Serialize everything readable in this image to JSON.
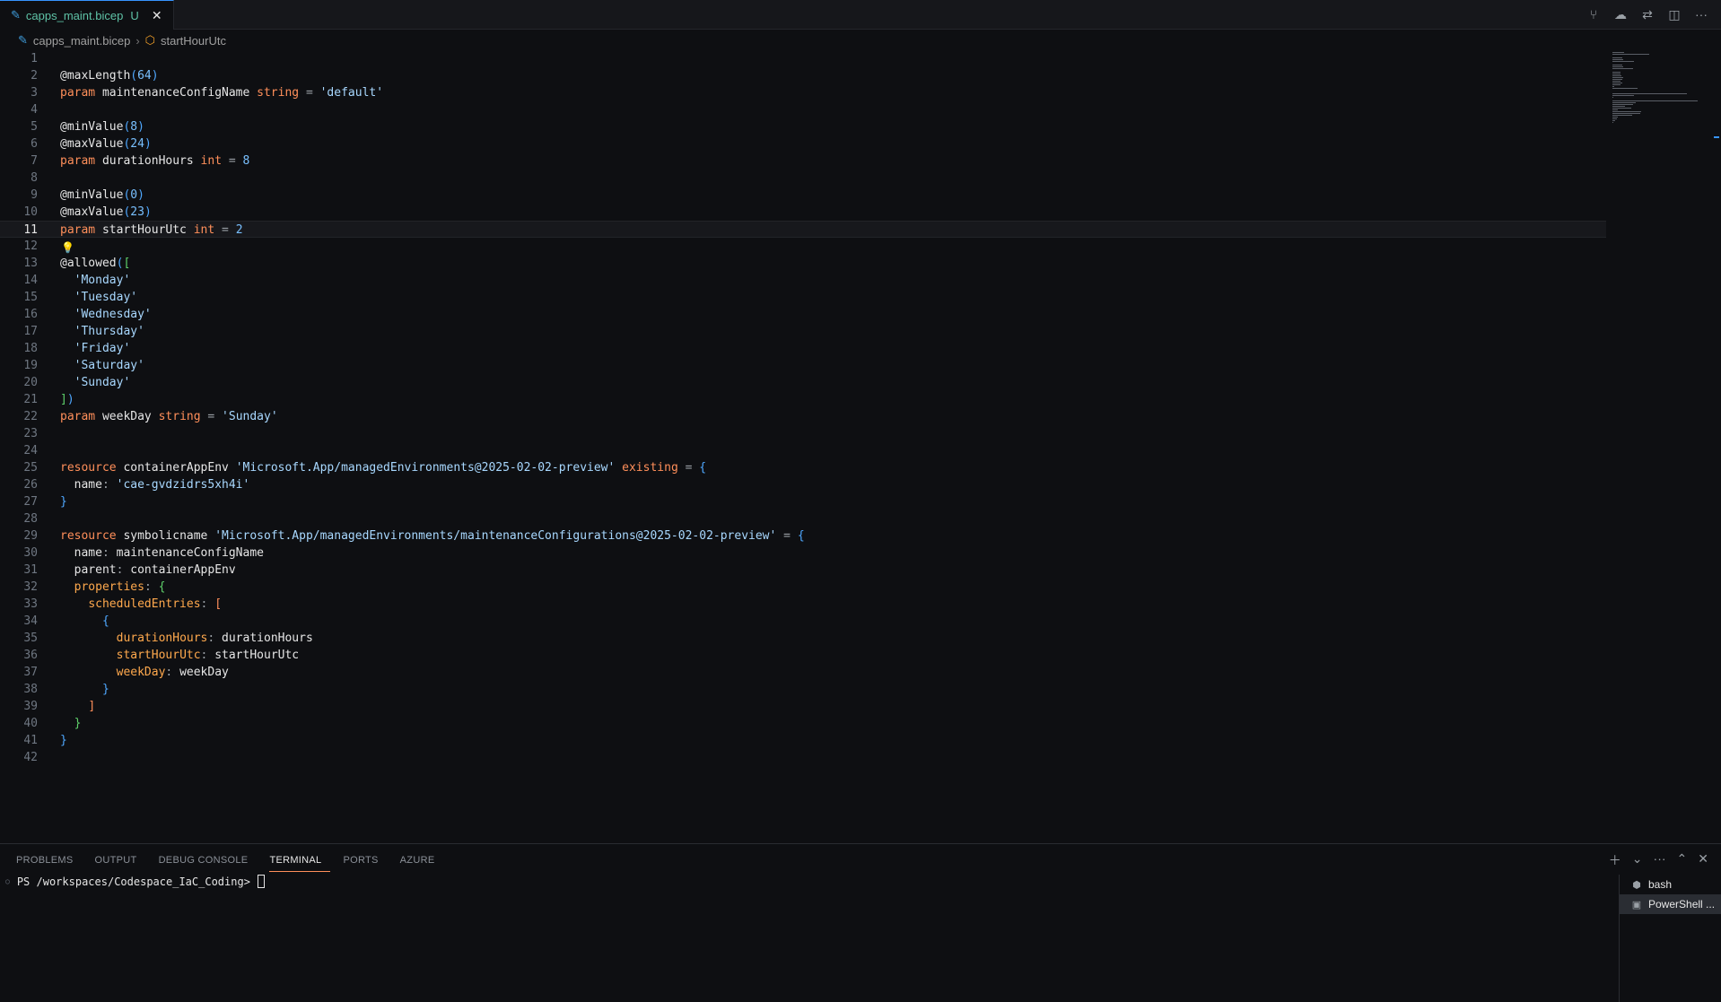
{
  "tab": {
    "label": "capps_maint.bicep",
    "modified": "U",
    "close": "✕"
  },
  "toolbar_icons": [
    "source-control-graph-icon",
    "cloud-upload-icon",
    "compare-changes-icon",
    "split-editor-icon",
    "more-actions-icon"
  ],
  "breadcrumb": {
    "file": "capps_maint.bicep",
    "symbol": "startHourUtc"
  },
  "editor": {
    "current_line": 11,
    "lines": [
      [],
      [
        [
          "dec",
          "@maxLength"
        ],
        [
          "b1",
          "("
        ],
        [
          "num",
          "64"
        ],
        [
          "b1",
          ")"
        ]
      ],
      [
        [
          "kw",
          "param"
        ],
        [
          "id",
          " maintenanceConfigName "
        ],
        [
          "type",
          "string"
        ],
        [
          "p",
          " = "
        ],
        [
          "str",
          "'default'"
        ]
      ],
      [],
      [
        [
          "dec",
          "@minValue"
        ],
        [
          "b1",
          "("
        ],
        [
          "num",
          "8"
        ],
        [
          "b1",
          ")"
        ]
      ],
      [
        [
          "dec",
          "@maxValue"
        ],
        [
          "b1",
          "("
        ],
        [
          "num",
          "24"
        ],
        [
          "b1",
          ")"
        ]
      ],
      [
        [
          "kw",
          "param"
        ],
        [
          "id",
          " durationHours "
        ],
        [
          "type",
          "int"
        ],
        [
          "p",
          " = "
        ],
        [
          "num",
          "8"
        ]
      ],
      [],
      [
        [
          "dec",
          "@minValue"
        ],
        [
          "b1",
          "("
        ],
        [
          "num",
          "0"
        ],
        [
          "b1",
          ")"
        ]
      ],
      [
        [
          "dec",
          "@maxValue"
        ],
        [
          "b1",
          "("
        ],
        [
          "num",
          "23"
        ],
        [
          "b1",
          ")"
        ]
      ],
      [
        [
          "kw",
          "param"
        ],
        [
          "id",
          " startHourUtc "
        ],
        [
          "type",
          "int"
        ],
        [
          "p",
          " = "
        ],
        [
          "num",
          "2"
        ]
      ],
      [],
      [
        [
          "dec",
          "@allowed"
        ],
        [
          "b1",
          "("
        ],
        [
          "b2",
          "["
        ]
      ],
      [
        [
          "p",
          "  "
        ],
        [
          "str",
          "'Monday'"
        ]
      ],
      [
        [
          "p",
          "  "
        ],
        [
          "str",
          "'Tuesday'"
        ]
      ],
      [
        [
          "p",
          "  "
        ],
        [
          "str",
          "'Wednesday'"
        ]
      ],
      [
        [
          "p",
          "  "
        ],
        [
          "str",
          "'Thursday'"
        ]
      ],
      [
        [
          "p",
          "  "
        ],
        [
          "str",
          "'Friday'"
        ]
      ],
      [
        [
          "p",
          "  "
        ],
        [
          "str",
          "'Saturday'"
        ]
      ],
      [
        [
          "p",
          "  "
        ],
        [
          "str",
          "'Sunday'"
        ]
      ],
      [
        [
          "b2",
          "]"
        ],
        [
          "b1",
          ")"
        ]
      ],
      [
        [
          "kw",
          "param"
        ],
        [
          "id",
          " weekDay "
        ],
        [
          "type",
          "string"
        ],
        [
          "p",
          " = "
        ],
        [
          "str",
          "'Sunday'"
        ]
      ],
      [],
      [],
      [
        [
          "kw",
          "resource"
        ],
        [
          "id",
          " containerAppEnv "
        ],
        [
          "str",
          "'Microsoft.App/managedEnvironments@2025-02-02-preview'"
        ],
        [
          "kw",
          " existing"
        ],
        [
          "p",
          " = "
        ],
        [
          "b1",
          "{"
        ]
      ],
      [
        [
          "p",
          "  "
        ],
        [
          "id",
          "name"
        ],
        [
          "p",
          ": "
        ],
        [
          "str",
          "'cae-gvdzidrs5xh4i'"
        ]
      ],
      [
        [
          "b1",
          "}"
        ]
      ],
      [],
      [
        [
          "kw",
          "resource"
        ],
        [
          "id",
          " symbolicname "
        ],
        [
          "str",
          "'Microsoft.App/managedEnvironments/maintenanceConfigurations@2025-02-02-preview'"
        ],
        [
          "p",
          " = "
        ],
        [
          "b1",
          "{"
        ]
      ],
      [
        [
          "p",
          "  "
        ],
        [
          "id",
          "name"
        ],
        [
          "p",
          ": "
        ],
        [
          "id",
          "maintenanceConfigName"
        ]
      ],
      [
        [
          "p",
          "  "
        ],
        [
          "id",
          "parent"
        ],
        [
          "p",
          ": "
        ],
        [
          "id",
          "containerAppEnv"
        ]
      ],
      [
        [
          "p",
          "  "
        ],
        [
          "prop",
          "properties"
        ],
        [
          "p",
          ": "
        ],
        [
          "b2",
          "{"
        ]
      ],
      [
        [
          "p",
          "    "
        ],
        [
          "prop",
          "scheduledEntries"
        ],
        [
          "p",
          ": "
        ],
        [
          "b3",
          "["
        ]
      ],
      [
        [
          "p",
          "      "
        ],
        [
          "b1",
          "{"
        ]
      ],
      [
        [
          "p",
          "        "
        ],
        [
          "prop",
          "durationHours"
        ],
        [
          "p",
          ": "
        ],
        [
          "id",
          "durationHours"
        ]
      ],
      [
        [
          "p",
          "        "
        ],
        [
          "prop",
          "startHourUtc"
        ],
        [
          "p",
          ": "
        ],
        [
          "id",
          "startHourUtc"
        ]
      ],
      [
        [
          "p",
          "        "
        ],
        [
          "prop",
          "weekDay"
        ],
        [
          "p",
          ": "
        ],
        [
          "id",
          "weekDay"
        ]
      ],
      [
        [
          "p",
          "      "
        ],
        [
          "b1",
          "}"
        ]
      ],
      [
        [
          "p",
          "    "
        ],
        [
          "b3",
          "]"
        ]
      ],
      [
        [
          "p",
          "  "
        ],
        [
          "b2",
          "}"
        ]
      ],
      [
        [
          "b1",
          "}"
        ]
      ],
      []
    ]
  },
  "panel": {
    "tabs": [
      "PROBLEMS",
      "OUTPUT",
      "DEBUG CONSOLE",
      "TERMINAL",
      "PORTS",
      "AZURE"
    ],
    "active_tab": "TERMINAL",
    "prompt": "PS /workspaces/Codespace_IaC_Coding>",
    "terminals": [
      {
        "name": "bash",
        "active": false
      },
      {
        "name": "PowerShell ...",
        "active": true
      }
    ]
  },
  "colors": {
    "accent": "#3794ff",
    "tab_text": "#5ec2a6",
    "keyword": "#ff8f5a",
    "string": "#a8d8ff",
    "number": "#79c0ff"
  }
}
